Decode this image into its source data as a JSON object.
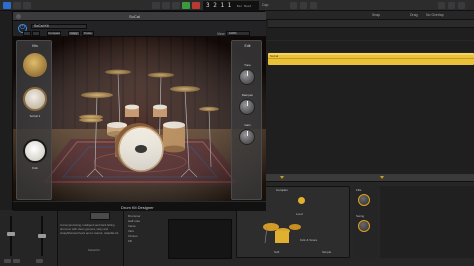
{
  "main": {
    "lcd_position": "3 2 1 1",
    "lcd_subtext": "Bar Beat",
    "tempo_text": "Cap",
    "right_labels": [
      "Snap",
      "Drag",
      "No Overlap"
    ]
  },
  "plugin": {
    "window_title": "SoCal",
    "preset_name": "SoCal Kit",
    "header_buttons": [
      "Compare",
      "Copy",
      "Paste"
    ],
    "view_label": "View",
    "view_value": "100%",
    "footer_label": "Drum Kit Designer",
    "kit_panel_title": "Kits",
    "kit_pieces": [
      {
        "label": "",
        "icon": "cymbal-icon"
      },
      {
        "label": "SoCal 1",
        "icon": "snare-icon"
      },
      {
        "label": "Kick",
        "icon": "kick-drum-icon"
      }
    ],
    "edit_panel_title": "Edit",
    "knobs": [
      "Tune",
      "Dampen",
      "Gain"
    ]
  },
  "drummer": {
    "description": "Uncompromising, intelligent and hard-hitting drummer with clean grooves, tasty and straightforward feels and a natural, relatable kit.",
    "library_name": "SoCal Kit",
    "list_items": [
      "Drummer",
      "Half note",
      "Verse",
      "Intro",
      "Chorus",
      "Fill"
    ],
    "xy_label": "Complex",
    "xy_left": "Loud",
    "xy_bottom": "Soft",
    "xy_right": "Simple",
    "controls": [
      "Fills",
      "Swing"
    ],
    "follow_label": "Kick & Snare",
    "region_label": "SoCal"
  },
  "colors": {
    "region": "#e9c23a",
    "accent_blue": "#3c8fe6",
    "knob_ring": "#e0a020"
  }
}
